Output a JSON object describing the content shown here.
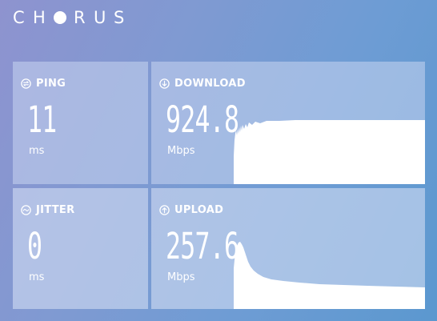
{
  "brand": {
    "letters_before": [
      "C",
      "H"
    ],
    "letters_after": [
      "R",
      "U",
      "S"
    ]
  },
  "ping": {
    "label": "PING",
    "value": "11",
    "unit": "ms",
    "icon": "ping-icon"
  },
  "download": {
    "label": "DOWNLOAD",
    "value": "924.8",
    "unit": "Mbps",
    "icon": "download-arrow-icon"
  },
  "jitter": {
    "label": "JITTER",
    "value": "0",
    "unit": "ms",
    "icon": "jitter-wave-icon"
  },
  "upload": {
    "label": "UPLOAD",
    "value": "257.6",
    "unit": "Mbps",
    "icon": "upload-arrow-icon"
  },
  "colors": {
    "tile": "#c8d6f0",
    "text": "#ffffff",
    "graph_fill": "#ffffff"
  }
}
